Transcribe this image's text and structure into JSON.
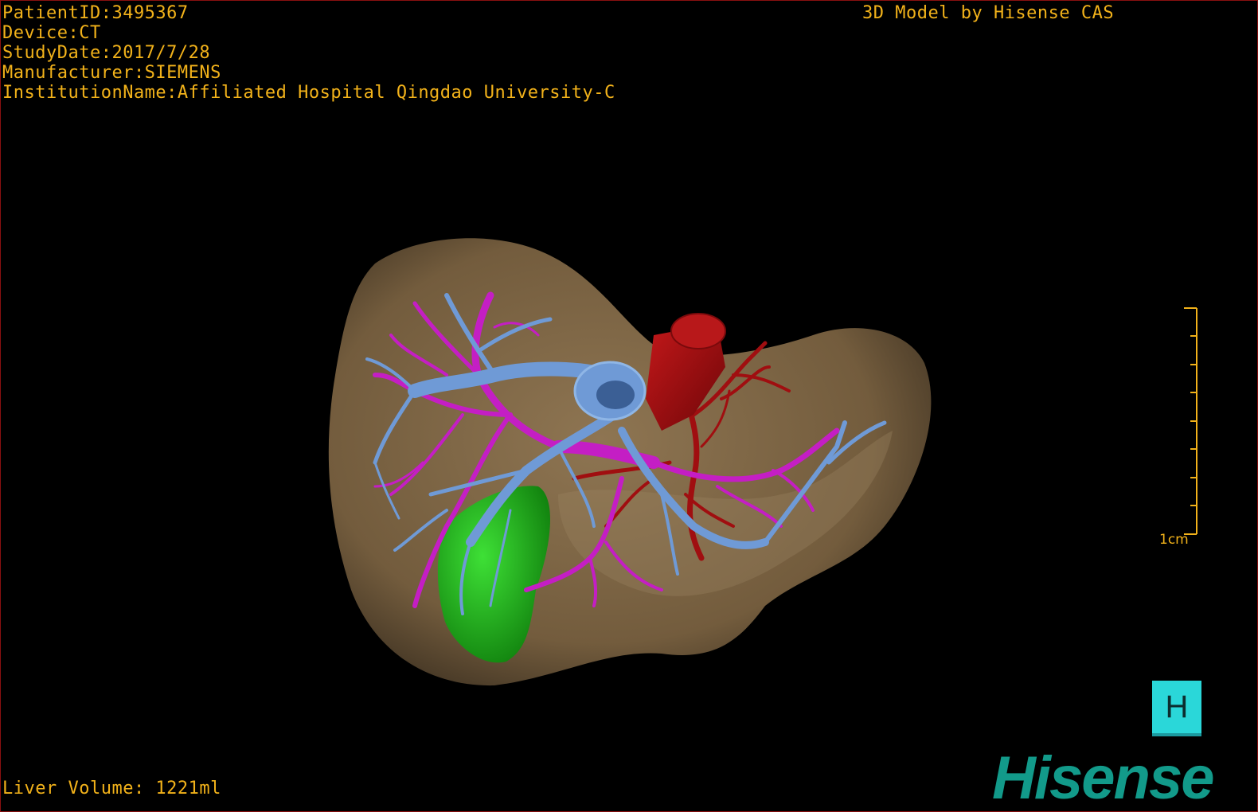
{
  "overlay": {
    "patient_id": "PatientID:3495367",
    "device": "Device:CT",
    "study_date": "StudyDate:2017/7/28",
    "manufacturer": "Manufacturer:SIEMENS",
    "institution": "InstitutionName:Affiliated Hospital Qingdao University-C",
    "title": "3D Model by Hisense CAS",
    "liver_volume": "Liver Volume: 1221ml"
  },
  "scale_bar": {
    "label": "1cm",
    "ticks": 9
  },
  "orientation_cube": {
    "face_label": "H"
  },
  "brand": {
    "logo_text": "Hisense"
  },
  "colors": {
    "overlay_text": "#f2b21a",
    "liver": "#7a6446",
    "hepatic_vein": "#6f9ad6",
    "portal_vein": "#c41ec4",
    "artery": "#a00e10",
    "tumor": "#1fb81a",
    "cube": "#2ad7d9",
    "brand": "#129a8a"
  }
}
